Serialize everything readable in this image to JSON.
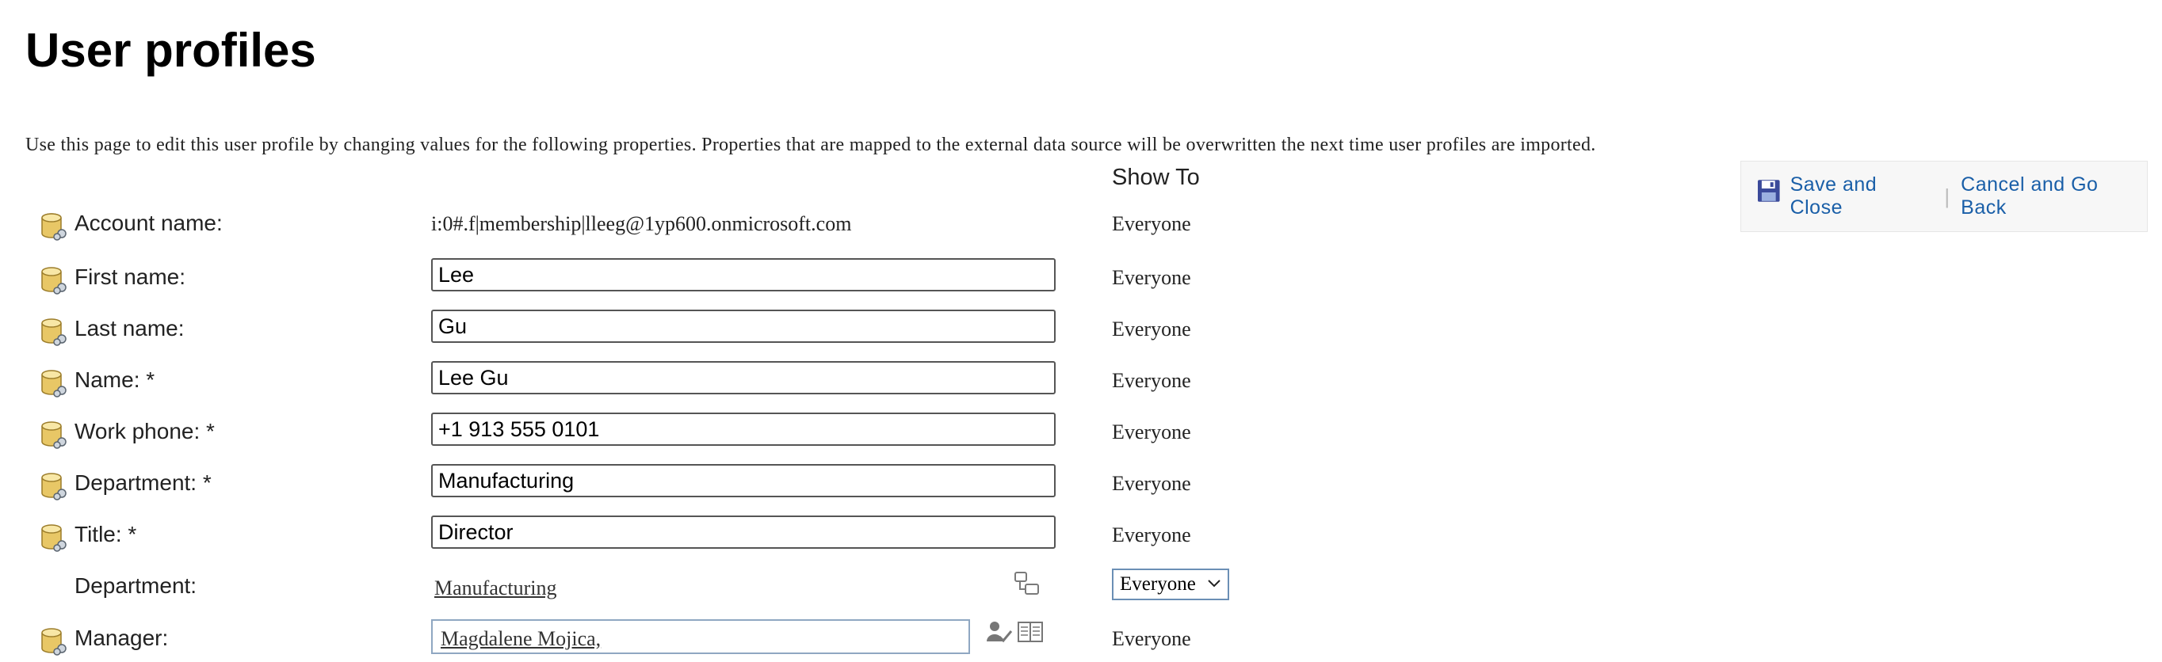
{
  "page": {
    "title": "User profiles",
    "intro": "Use this page to edit this user profile by changing values for the following properties. Properties that are mapped to the external data source will be overwritten the next time user profiles are imported.",
    "show_to_header": "Show To"
  },
  "actions": {
    "save_label": "Save and Close",
    "separator": "|",
    "cancel_label": "Cancel and Go Back",
    "link_color": "#1a5fa8"
  },
  "fields": {
    "account_name": {
      "label": "Account name:",
      "value": "i:0#.f|membership|lleeg@1yp600.onmicrosoft.com",
      "show_to": "Everyone"
    },
    "first_name": {
      "label": "First name:",
      "value": "Lee",
      "show_to": "Everyone"
    },
    "last_name": {
      "label": "Last name:",
      "value": "Gu",
      "show_to": "Everyone"
    },
    "name": {
      "label": "Name: *",
      "value": "Lee Gu",
      "show_to": "Everyone"
    },
    "work_phone": {
      "label": "Work phone: *",
      "value": "+1 913 555 0101",
      "show_to": "Everyone"
    },
    "department_required": {
      "label": "Department: *",
      "value": "Manufacturing",
      "show_to": "Everyone"
    },
    "title": {
      "label": "Title: *",
      "value": "Director",
      "show_to": "Everyone"
    },
    "department_taxonomy": {
      "label": "Department:",
      "value": "Manufacturing",
      "show_to_selected": "Everyone"
    },
    "manager": {
      "label": "Manager:",
      "value": "Magdalene Mojica,",
      "show_to": "Everyone"
    }
  },
  "icons": {
    "mapped_property": "database-mapped-icon",
    "save": "floppy-disk-icon",
    "taxonomy_picker": "taxonomy-browse-icon",
    "check_names": "check-names-icon",
    "address_book": "address-book-icon"
  }
}
